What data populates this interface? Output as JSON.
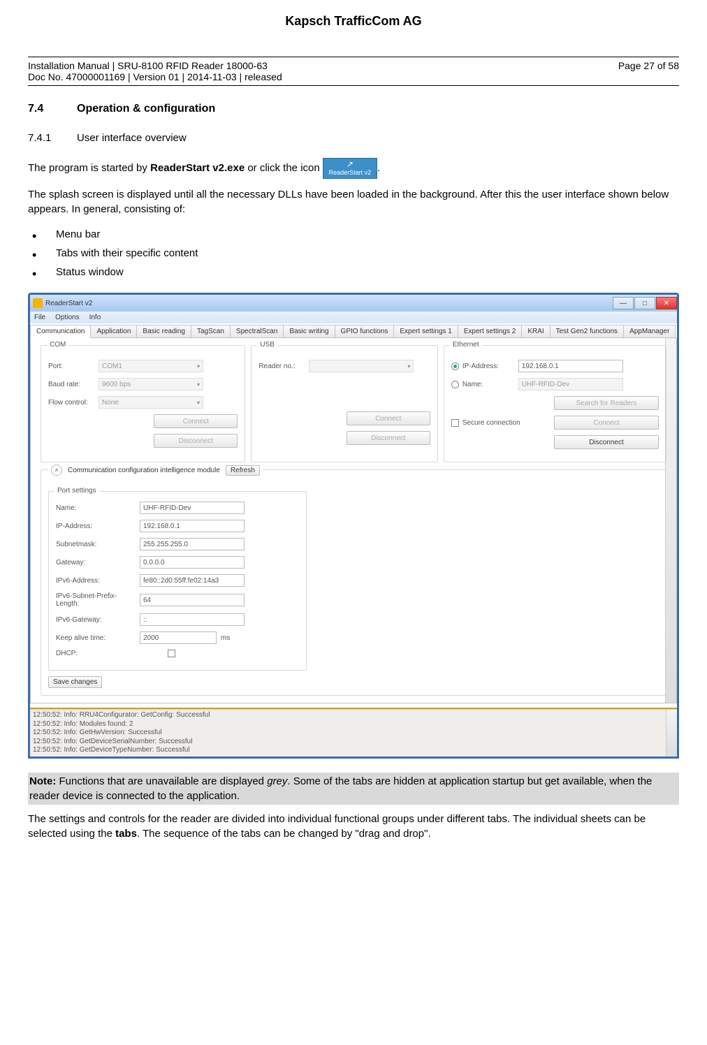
{
  "doc": {
    "company": "Kapsch TrafficCom AG",
    "header_line1": "Installation Manual | SRU-8100 RFID Reader 18000-63",
    "header_line2": "Doc No. 47000001169 | Version 01 | 2014-11-03 | released",
    "page": "Page 27 of 58",
    "section_num": "7.4",
    "section_title": "Operation & configuration",
    "subsection_num": "7.4.1",
    "subsection_title": "User interface overview",
    "para1_a": "The program is started by ",
    "para1_b": "ReaderStart v2.exe",
    "para1_c": " or click the icon ",
    "para1_d": ".",
    "icon_label": "ReaderStart v2",
    "para2": "The splash screen is displayed until all the necessary DLLs have been loaded in the background. After this the user interface shown below appears. In general, consisting of:",
    "bullets": [
      "Menu bar",
      "Tabs with their specific content",
      "Status window"
    ],
    "note_label": "Note:",
    "note_text_a": " Functions that are unavailable are displayed ",
    "note_text_grey": "grey",
    "note_text_b": ". Some of the tabs are hidden at application startup but get available, when the reader device is connected to the application.",
    "para3_a": "The settings and controls for the reader are divided into individual functional groups under different tabs. The individual sheets can be selected using the ",
    "para3_tabs": "tabs",
    "para3_b": ". The sequence of the tabs can be changed by \"drag and drop\"."
  },
  "app": {
    "title": "ReaderStart v2",
    "menu": [
      "File",
      "Options",
      "Info"
    ],
    "tabs": [
      "Communication",
      "Application",
      "Basic reading",
      "TagScan",
      "SpectralScan",
      "Basic writing",
      "GPIO functions",
      "Expert settings 1",
      "Expert settings 2",
      "KRAI",
      "Test Gen2 functions",
      "AppManager"
    ],
    "com": {
      "title": "COM",
      "port_label": "Port:",
      "port_value": "COM1",
      "baud_label": "Baud rate:",
      "baud_value": "9600 bps",
      "flow_label": "Flow control:",
      "flow_value": "None",
      "connect": "Connect",
      "disconnect": "Disconnect"
    },
    "usb": {
      "title": "USB",
      "reader_label": "Reader no.:",
      "connect": "Connect",
      "disconnect": "Disconnect"
    },
    "eth": {
      "title": "Ethernet",
      "ip_label": "IP-Address:",
      "ip_value": "192.168.0.1",
      "name_label": "Name:",
      "name_value": "UHF-RFID-Dev",
      "search": "Search for Readers",
      "secure": "Secure connection",
      "connect": "Connect",
      "disconnect": "Disconnect"
    },
    "exp": {
      "title": "Communication configuration intelligence module",
      "refresh": "Refresh",
      "port_title": "Port settings",
      "fields": {
        "name_l": "Name:",
        "name_v": "UHF-RFID-Dev",
        "ip_l": "IP-Address:",
        "ip_v": "192.168.0.1",
        "sub_l": "Subnetmask:",
        "sub_v": "255.255.255.0",
        "gw_l": "Gateway:",
        "gw_v": "0.0.0.0",
        "ip6_l": "IPv6-Address:",
        "ip6_v": "fe80::2d0:55ff:fe02:14a3",
        "ip6s_l": "IPv6-Subnet-Prefix-Length:",
        "ip6s_v": "64",
        "ip6g_l": "IPv6-Gateway:",
        "ip6g_v": "::",
        "keep_l": "Keep alive time:",
        "keep_v": "2000",
        "keep_u": "ms",
        "dhcp_l": "DHCP:"
      },
      "save": "Save changes"
    },
    "log": [
      "12:50:52: Info: RRU4Configurator: GetConfig: Successful",
      "12:50:52: Info: Modules found: 2",
      "12:50:52: Info: GetHwVersion: Successful",
      "12:50:52: Info: GetDeviceSerialNumber: Successful",
      "12:50:52: Info: GetDeviceTypeNumber: Successful"
    ]
  }
}
